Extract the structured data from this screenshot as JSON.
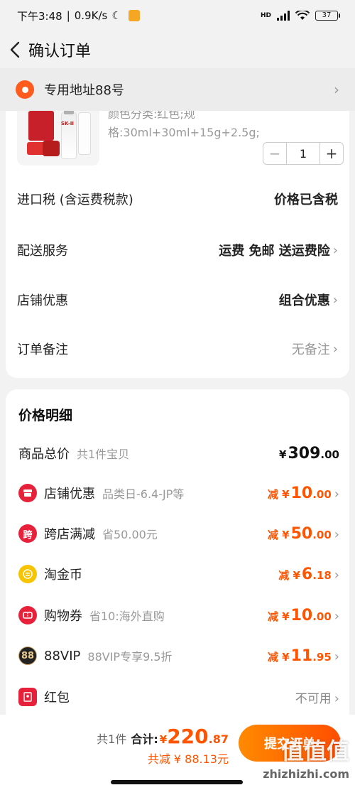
{
  "status_bar": {
    "time": "下午3:48",
    "network_speed": "0.9K/s",
    "moon": "☾",
    "signal_label": "HD",
    "battery": "37"
  },
  "nav": {
    "title": "确认订单"
  },
  "address": {
    "text": "专用地址88号"
  },
  "product": {
    "brand_text": "SK-II",
    "spec": "颜色分类:红色;规格:30ml+30ml+15g+2.5g;",
    "quantity": "1",
    "minus": "−",
    "plus": "+"
  },
  "order_rows": [
    {
      "label": "进口税 (含运费税款)",
      "value": "价格已含税"
    },
    {
      "label": "配送服务",
      "value": "运费 免邮 送运费险"
    },
    {
      "label": "店铺优惠",
      "value": "组合优惠"
    },
    {
      "label": "订单备注",
      "value": "无备注"
    }
  ],
  "price_detail": {
    "title": "价格明细",
    "rows": [
      {
        "label": "商品总价",
        "sub": "共1件宝贝",
        "prefix": "¥",
        "amount": "309",
        "decimal": ".00"
      },
      {
        "label": "店铺优惠",
        "sub": "品类日-6.4-JP等",
        "prefix": "减 ¥",
        "amount": "10",
        "decimal": ".00"
      },
      {
        "label": "跨店满减",
        "sub": "省50.00元",
        "icon_text": "跨",
        "prefix": "减 ¥",
        "amount": "50",
        "decimal": ".00"
      },
      {
        "label": "淘金币",
        "sub": "",
        "prefix": "减 ¥",
        "amount": "6",
        "decimal": ".18"
      },
      {
        "label": "购物券",
        "sub": "省10:海外直购",
        "prefix": "减 ¥",
        "amount": "10",
        "decimal": ".00"
      },
      {
        "label": "88VIP",
        "sub": "88VIP专享9.5折",
        "icon_text": "88",
        "prefix": "减 ¥",
        "amount": "11",
        "decimal": ".95"
      },
      {
        "label": "红包",
        "sub": "",
        "value": "不可用"
      }
    ]
  },
  "footer": {
    "count": "共1件",
    "total_label": "合计:",
    "yen": "¥",
    "total_amount": "220",
    "total_decimal": ".87",
    "saved": "共减 ¥ 88.13元",
    "submit": "提交订单"
  },
  "watermark": {
    "brand": "值值值",
    "url": "zhizhizhi.com"
  },
  "colors": {
    "accent": "#ff5500",
    "pin": "#ff5b1d",
    "shop_icon": "#e8213b",
    "coin": "#f6c400"
  }
}
